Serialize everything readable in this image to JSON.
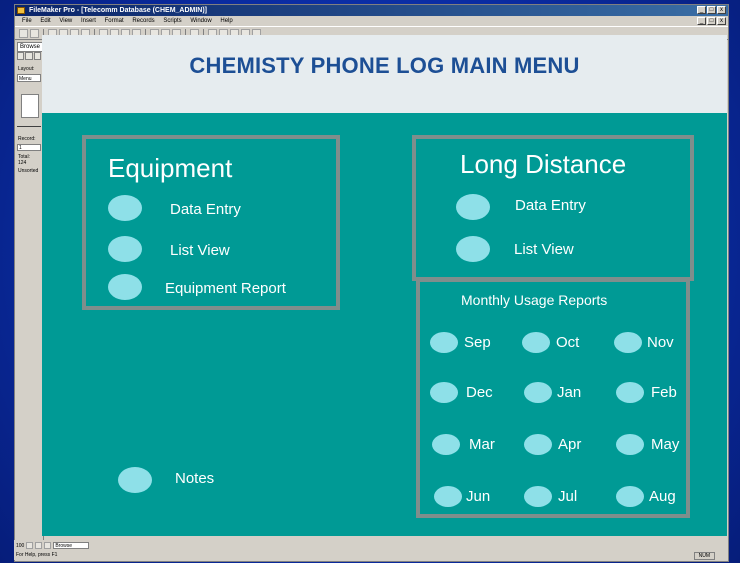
{
  "window": {
    "title": "FileMaker Pro - [Telecomm Database (CHEM_ADMIN)]",
    "minimize": "_",
    "maximize": "□",
    "close": "x"
  },
  "menubar": [
    "File",
    "Edit",
    "View",
    "Insert",
    "Format",
    "Records",
    "Scripts",
    "Window",
    "Help"
  ],
  "status_area": {
    "mode": "Browse",
    "layout_label": "Layout:",
    "layout_value": "Menu",
    "record_label": "Record:",
    "record_value": "1",
    "total_label": "Total:",
    "total_value": "124",
    "sort_state": "Unsorted"
  },
  "header": {
    "title": "CHEMISTY PHONE LOG MAIN MENU"
  },
  "equipment": {
    "title": "Equipment",
    "buttons": [
      "Data Entry",
      "List View",
      "Equipment Report"
    ]
  },
  "long_distance": {
    "title": "Long Distance",
    "buttons": [
      "Data Entry",
      "List View"
    ]
  },
  "monthly": {
    "title": "Monthly Usage Reports",
    "months": [
      "Sep",
      "Oct",
      "Nov",
      "Dec",
      "Jan",
      "Feb",
      "Mar",
      "Apr",
      "May",
      "Jun",
      "Jul",
      "Aug"
    ]
  },
  "notes": {
    "label": "Notes"
  },
  "bottom_bar": {
    "zoom": "100",
    "mode": "Browse",
    "help": "For Help, press F1",
    "indicator": "NUM"
  },
  "colors": {
    "background": "#009a95",
    "header_bg": "#e6ecef",
    "title_color": "#1d4f95",
    "button_oval": "#8ee0e8",
    "box_border": "#7f8e8c"
  }
}
